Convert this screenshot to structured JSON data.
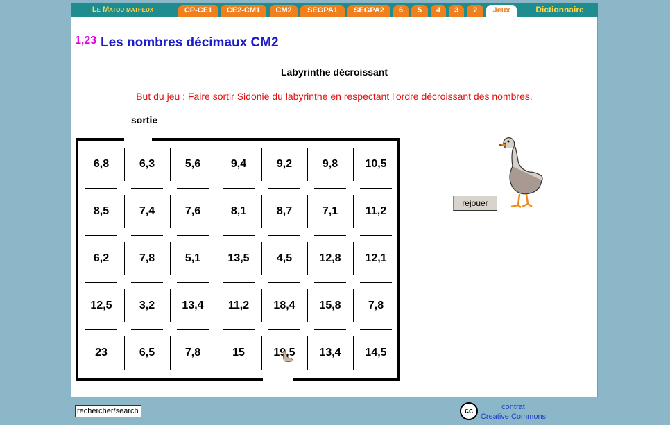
{
  "nav": {
    "brand": "Le Matou matheux",
    "tabs": [
      {
        "label": "CP-CE1"
      },
      {
        "label": "CE2-CM1"
      },
      {
        "label": "CM2"
      },
      {
        "label": "SEGPA1"
      },
      {
        "label": "SEGPA2"
      },
      {
        "label": "6"
      },
      {
        "label": "5"
      },
      {
        "label": "4"
      },
      {
        "label": "3"
      },
      {
        "label": "2"
      },
      {
        "label": "Jeux"
      }
    ],
    "active_tab": "Jeux",
    "dictionary": "Dictionnaire"
  },
  "header": {
    "badge": "1,23",
    "title": "Les nombres décimaux CM2"
  },
  "game": {
    "title": "Labyrinthe décroissant",
    "goal": "But du jeu : Faire sortir Sidonie du labyrinthe en respectant l'ordre décroissant des nombres.",
    "exit_label": "sortie",
    "grid": [
      [
        "6,8",
        "6,3",
        "5,6",
        "9,4",
        "9,2",
        "9,8",
        "10,5"
      ],
      [
        "8,5",
        "7,4",
        "7,6",
        "8,1",
        "8,7",
        "7,1",
        "11,2"
      ],
      [
        "6,2",
        "7,8",
        "5,1",
        "13,5",
        "4,5",
        "12,8",
        "12,1"
      ],
      [
        "12,5",
        "3,2",
        "13,4",
        "11,2",
        "18,4",
        "15,8",
        "7,8"
      ],
      [
        "23",
        "6,5",
        "7,8",
        "15",
        "19,5",
        "13,4",
        "14,5"
      ]
    ],
    "player_icon": "goose-icon",
    "replay_label": "rejouer"
  },
  "footer": {
    "search_value": "rechercher/search",
    "license_line1": "contrat",
    "license_line2": "Creative Commons",
    "cc_icon_text": "cc"
  },
  "colors": {
    "background": "#8cb7c9",
    "nav_bar": "#1f8d8f",
    "tab": "#f07f1e",
    "brand": "#ffd84a",
    "title": "#1c1ccc",
    "goal_text": "#e01010",
    "badge": "#e000e0"
  }
}
